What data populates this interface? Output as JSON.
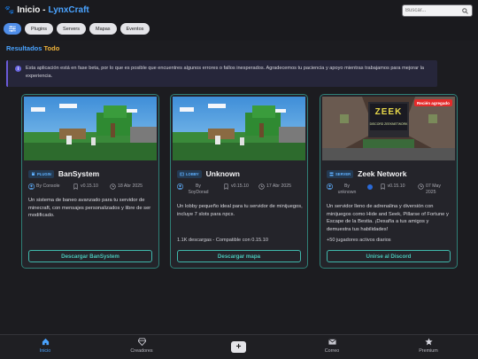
{
  "header": {
    "brand_prefix": "Inicio - ",
    "brand_name": "LynxCraft",
    "search_placeholder": "Buscar...",
    "filter_icon": "sliders-icon",
    "chips": [
      "Plugins",
      "Servers",
      "Mapas",
      "Eventos"
    ]
  },
  "results": {
    "label": "Resultados",
    "filter": "Todo"
  },
  "notice": {
    "text": "Esta aplicación está en fase beta, por lo que es posible que encuentres algunos errores o fallos inesperados. Agradecemos tu paciencia y apoyo mientras trabajamos para mejorar la experiencia."
  },
  "cards": [
    {
      "tag": "PLUGIN",
      "name": "BanSystem",
      "author": "By Console",
      "version": "v0.15.10",
      "date": "18 Abr 2025",
      "description": "Un sistema de baneo avanzado para tu servidor de minecraft, con mensajes personalizados y libre de ser modificado.",
      "extra": "",
      "button": "Descargar BanSystem"
    },
    {
      "tag": "LOBBY",
      "name": "Unknown",
      "author": "By SoyDorad",
      "version": "v0.15.10",
      "date": "17 Abr 2025",
      "description": "Un lobby pequeño ideal para tu servidor de minijuegos, incluye 7 slots para npcs.",
      "extra": "1.1K descargas - Compatible con 0.15.10",
      "button": "Descargar mapa"
    },
    {
      "tag": "SERVER",
      "name": "Zeek Network",
      "author": "By unknown",
      "version": "v0.15.10",
      "date": "07 May 2025",
      "badge": "Recién agregado",
      "description": "Un servidor lleno de adrenalina y diversión con minijuegos como Hide and Seek, Pillarse of Fortune y Escape de la Bestia. ¡Desafía a tus amigos y demuestra tus habilidades!",
      "extra": "+50 jugadores activos diarios",
      "button": "Unirse al Discord",
      "sign_text": "ZEEK",
      "sign_subtext": "DISCORD ZEEKNETWORK"
    }
  ],
  "bottom_nav": {
    "items": [
      {
        "label": "Inicio",
        "icon": "home-icon",
        "active": true
      },
      {
        "label": "Creadores",
        "icon": "gem-icon"
      },
      {
        "label": "Correo",
        "icon": "mail-icon"
      },
      {
        "label": "Premium",
        "icon": "star-icon"
      }
    ],
    "plus_icon": "plus-icon"
  },
  "colors": {
    "accent": "#4aa3ff",
    "highlight": "#f0b33a",
    "card_border": "#2f7f76",
    "button_text": "#49c7ba",
    "badge": "#e52a2a"
  }
}
